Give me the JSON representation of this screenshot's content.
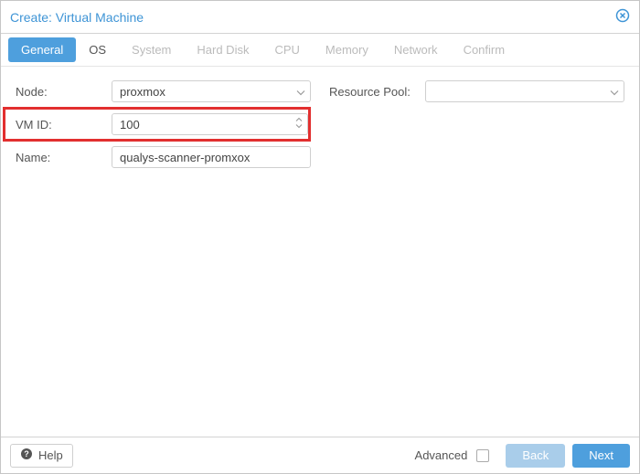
{
  "window": {
    "title": "Create: Virtual Machine"
  },
  "tabs": {
    "general": "General",
    "os": "OS",
    "system": "System",
    "harddisk": "Hard Disk",
    "cpu": "CPU",
    "memory": "Memory",
    "network": "Network",
    "confirm": "Confirm"
  },
  "form": {
    "node_label": "Node:",
    "node_value": "proxmox",
    "vmid_label": "VM ID:",
    "vmid_value": "100",
    "name_label": "Name:",
    "name_value": "qualys-scanner-promxox",
    "pool_label": "Resource Pool:",
    "pool_value": ""
  },
  "footer": {
    "help": "Help",
    "advanced": "Advanced",
    "back": "Back",
    "next": "Next"
  }
}
